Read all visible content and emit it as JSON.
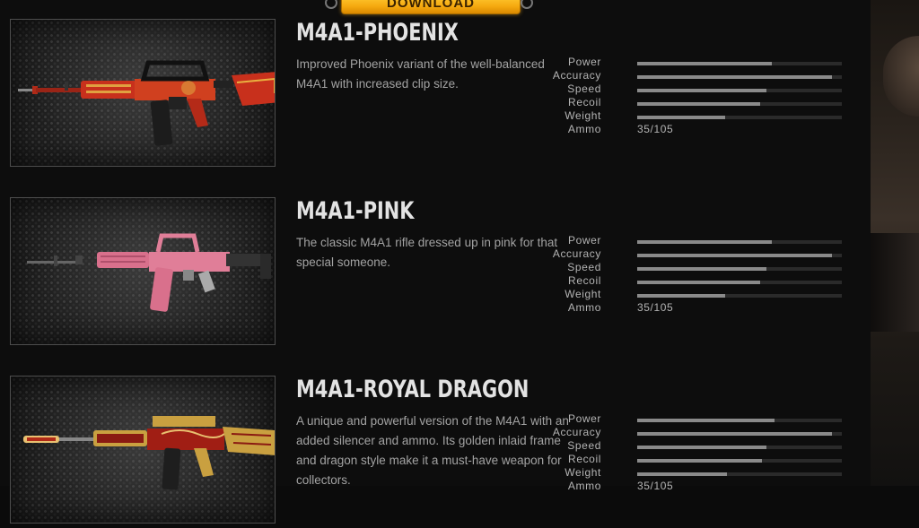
{
  "download": {
    "label": "DOWNLOAD"
  },
  "stat_labels": [
    "Power",
    "Accuracy",
    "Speed",
    "Recoil",
    "Weight",
    "Ammo"
  ],
  "items": [
    {
      "title": "M4A1-PHOENIX",
      "description": "Improved Phoenix variant of the well-balanced M4A1 with increased clip size.",
      "stats": {
        "power": 0.66,
        "accuracy": 0.95,
        "speed": 0.63,
        "recoil": 0.6,
        "weight": 0.43
      },
      "ammo": "35/105",
      "accent": "#c8301c"
    },
    {
      "title": "M4A1-PINK",
      "description": "The classic M4A1 rifle dressed up in pink for that special someone.",
      "stats": {
        "power": 0.66,
        "accuracy": 0.95,
        "speed": 0.63,
        "recoil": 0.6,
        "weight": 0.43
      },
      "ammo": "35/105",
      "accent": "#d9708c"
    },
    {
      "title": "M4A1-ROYAL DRAGON",
      "description": "A unique and powerful version of the M4A1 with an added silencer and ammo. Its golden inlaid frame and dragon style make it a must-have weapon for collectors.",
      "stats": {
        "power": 0.67,
        "accuracy": 0.95,
        "speed": 0.63,
        "recoil": 0.61,
        "weight": 0.44
      },
      "ammo": "35/105",
      "accent": "#c9a040"
    }
  ]
}
